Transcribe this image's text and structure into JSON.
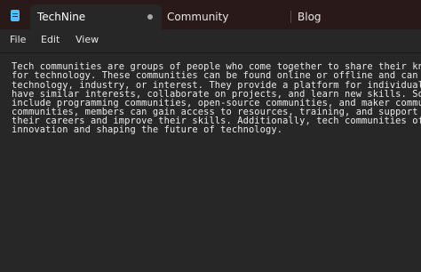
{
  "titlebar": {
    "app_icon": "notepad-icon",
    "tabs": [
      {
        "label": "TechNine",
        "active": true,
        "unsaved_indicator": "dot-icon"
      },
      {
        "label": "Community",
        "active": false
      },
      {
        "label": "Blog",
        "active": false
      }
    ]
  },
  "menu": {
    "items": [
      "File",
      "Edit",
      "View"
    ]
  },
  "editor": {
    "lines": [
      "Tech communities are groups of people who come together to share their kno",
      "for technology. These communities can be found online or offline and can b",
      "technology, industry, or interest. They provide a platform for individuals",
      "have similar interests, collaborate on projects, and learn new skills. Som",
      "include programming communities, open-source communities, and maker commun",
      "communities, members can gain access to resources, training, and support t",
      "their careers and improve their skills. Additionally, tech communities oft",
      "innovation and shaping the future of technology."
    ]
  },
  "colors": {
    "titlebar_bg": "#2a1919",
    "editor_bg": "#272727",
    "text": "#eaeaea",
    "accent_icon": "#4cc2ff"
  }
}
